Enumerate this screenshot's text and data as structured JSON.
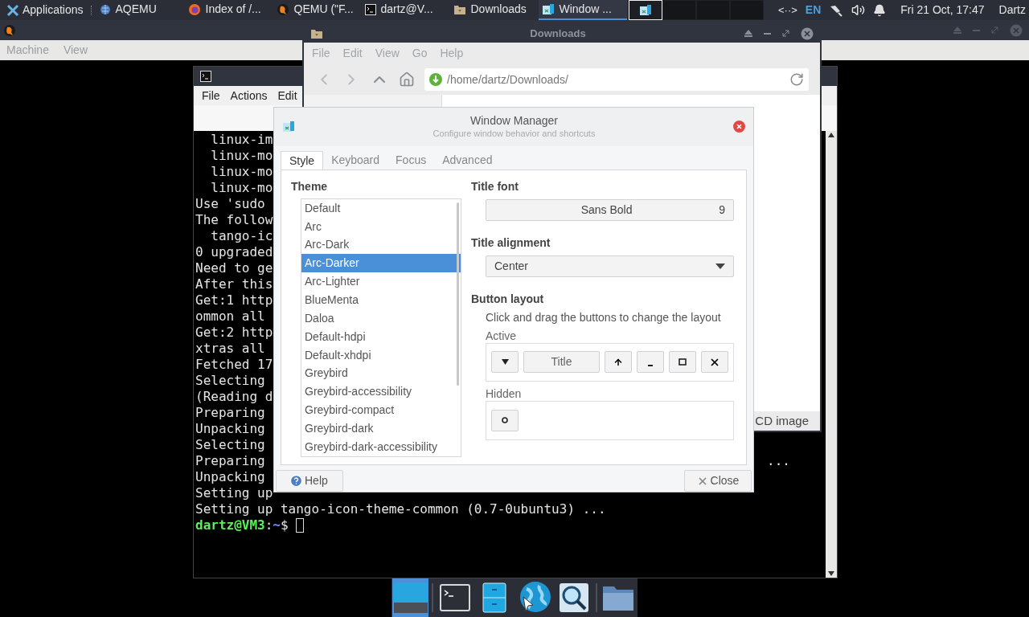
{
  "top_panel": {
    "apps_menu": "Applications",
    "tasks": [
      {
        "label": "AQEMU",
        "kind": "globe",
        "selected": false
      },
      {
        "label": "Index of /...",
        "kind": "firefox",
        "selected": false
      },
      {
        "label": "QEMU (\"F...",
        "kind": "qemu",
        "selected": false
      },
      {
        "label": "dartz@V...",
        "kind": "terminal",
        "selected": false
      },
      {
        "label": "Downloads",
        "kind": "folder",
        "selected": false
      },
      {
        "label": "Window ...",
        "kind": "wm",
        "selected": true
      }
    ],
    "workspaces": [
      {
        "selected": true
      },
      {
        "selected": false
      },
      {
        "selected": false
      },
      {
        "selected": false
      }
    ],
    "network_indicator": "<··>",
    "language": "EN",
    "clock": "Fri 21 Oct, 17:47",
    "user": "Dartz"
  },
  "qemu_window": {
    "menu": [
      "Machine",
      "View"
    ]
  },
  "terminal": {
    "menu": [
      "File",
      "Actions",
      "Edit"
    ],
    "lines": [
      {
        "text": "  linux-im"
      },
      {
        "text": "  linux-mo"
      },
      {
        "text": "  linux-mo"
      },
      {
        "text": "  linux-mo"
      },
      {
        "text": "Use 'sudo"
      },
      {
        "text": "The follow"
      },
      {
        "text": "  tango-ic"
      },
      {
        "text": "0 upgraded"
      },
      {
        "text": "Need to ge"
      },
      {
        "text": "After this"
      },
      {
        "text": "Get:1 http"
      },
      {
        "text": "ommon all"
      },
      {
        "text": "Get:2 http"
      },
      {
        "text": "xtras all"
      },
      {
        "text": "Fetched 17"
      },
      {
        "text": "Selecting"
      },
      {
        "text": "(Reading d"
      },
      {
        "text": "Preparing"
      },
      {
        "text": "Unpacking"
      },
      {
        "text": "Selecting"
      },
      {
        "text": "Preparing",
        "tail": "..."
      },
      {
        "text": "Unpacking"
      },
      {
        "text": "Setting up"
      },
      {
        "text": "Setting up tango-icon-theme-common (0.7-0ubuntu3) ..."
      }
    ],
    "prompt": {
      "user_host": "dartz@VM3",
      "separator": ":",
      "path": "~",
      "symbol": "$"
    }
  },
  "file_manager": {
    "title": "Downloads",
    "menu": [
      "File",
      "Edit",
      "View",
      "Go",
      "Help"
    ],
    "location": "/home/dartz/Downloads/",
    "status": "CD image"
  },
  "dialog": {
    "title": "Window Manager",
    "subtitle": "Configure window behavior and shortcuts",
    "tabs": [
      {
        "label": "Style",
        "selected": true
      },
      {
        "label": "Keyboard",
        "selected": false
      },
      {
        "label": "Focus",
        "selected": false
      },
      {
        "label": "Advanced",
        "selected": false
      }
    ],
    "theme_heading": "Theme",
    "themes": [
      {
        "label": "Default",
        "selected": false
      },
      {
        "label": "Arc",
        "selected": false
      },
      {
        "label": "Arc-Dark",
        "selected": false
      },
      {
        "label": "Arc-Darker",
        "selected": true
      },
      {
        "label": "Arc-Lighter",
        "selected": false
      },
      {
        "label": "BlueMenta",
        "selected": false
      },
      {
        "label": "Daloa",
        "selected": false
      },
      {
        "label": "Default-hdpi",
        "selected": false
      },
      {
        "label": "Default-xhdpi",
        "selected": false
      },
      {
        "label": "Greybird",
        "selected": false
      },
      {
        "label": "Greybird-accessibility",
        "selected": false
      },
      {
        "label": "Greybird-compact",
        "selected": false
      },
      {
        "label": "Greybird-dark",
        "selected": false
      },
      {
        "label": "Greybird-dark-accessibility",
        "selected": false
      }
    ],
    "title_font_heading": "Title font",
    "title_font": "Sans Bold",
    "title_font_size": "9",
    "alignment_heading": "Title alignment",
    "alignment": "Center",
    "layout_heading": "Button layout",
    "layout_hint": "Click and drag the buttons to change the layout",
    "active_label": "Active",
    "active_buttons": [
      {
        "kind": "menu"
      },
      {
        "kind": "title",
        "label": "Title"
      },
      {
        "kind": "shade"
      },
      {
        "kind": "minimize"
      },
      {
        "kind": "maximize"
      },
      {
        "kind": "close"
      }
    ],
    "hidden_label": "Hidden",
    "hidden_buttons": [
      {
        "kind": "stick"
      }
    ],
    "help": "Help",
    "close": "Close"
  },
  "dock": [
    {
      "kind": "desktop",
      "selected": true
    },
    {
      "kind": "terminal",
      "selected": false
    },
    {
      "kind": "files",
      "selected": false
    },
    {
      "kind": "browser",
      "selected": false
    },
    {
      "kind": "search",
      "selected": false
    },
    {
      "kind": "folder",
      "selected": false
    }
  ]
}
